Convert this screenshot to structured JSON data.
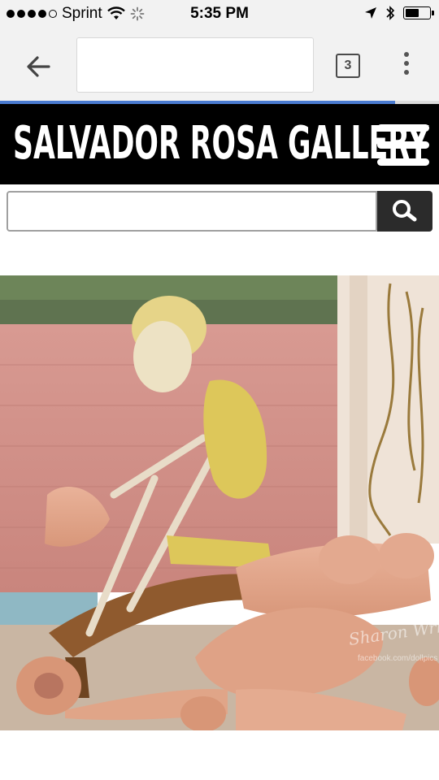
{
  "status_bar": {
    "carrier": "Sprint",
    "time": "5:35 PM",
    "signal_bars": 4,
    "signal_max": 5,
    "battery_level": 0.6
  },
  "browser": {
    "tab_count": "3",
    "page_load_progress": 0.9
  },
  "site": {
    "title": "SALVADOR ROSA GALLERY"
  },
  "search": {
    "value": "",
    "placeholder": ""
  },
  "artwork": {
    "watermark_line1": "Sharon Wright",
    "watermark_line2": "facebook.com/dollpics"
  },
  "colors": {
    "header_bg": "#000000",
    "progress": "#4a7bd0",
    "search_button": "#2b2b2b"
  },
  "icons": {
    "back": "arrow-left-icon",
    "tabs": "tab-switcher-icon",
    "menu": "more-vert-icon",
    "hamburger": "hamburger-menu-icon",
    "search": "magnifier-icon",
    "wifi": "wifi-icon",
    "location": "location-arrow-icon",
    "bluetooth": "bluetooth-icon",
    "battery": "battery-icon"
  }
}
